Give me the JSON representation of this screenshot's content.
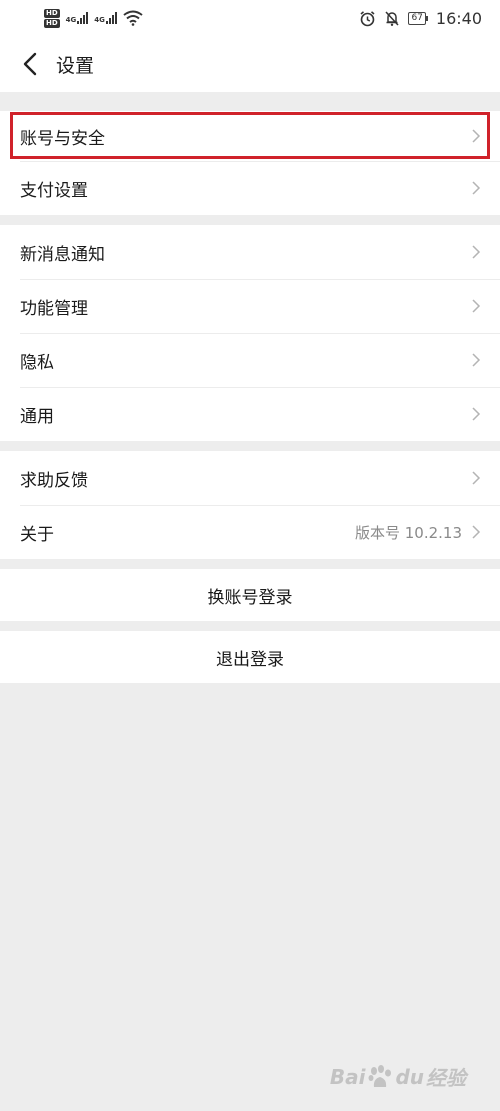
{
  "status_bar": {
    "hd1": "HD",
    "hd2": "HD",
    "net1": "4G",
    "net2": "4G",
    "battery": "67",
    "time": "16:40"
  },
  "nav": {
    "title": "设置"
  },
  "groups": [
    {
      "items": [
        {
          "label": "账号与安全"
        },
        {
          "label": "支付设置"
        }
      ]
    },
    {
      "items": [
        {
          "label": "新消息通知"
        },
        {
          "label": "功能管理"
        },
        {
          "label": "隐私"
        },
        {
          "label": "通用"
        }
      ]
    },
    {
      "items": [
        {
          "label": "求助反馈"
        },
        {
          "label": "关于",
          "value": "版本号 10.2.13"
        }
      ]
    }
  ],
  "actions": {
    "switch_account": "换账号登录",
    "logout": "退出登录"
  },
  "watermark": {
    "text_left": "Bai",
    "text_mid": "du",
    "text_right": "经验"
  },
  "colors": {
    "highlight": "#d0222a",
    "background": "#ededed"
  }
}
